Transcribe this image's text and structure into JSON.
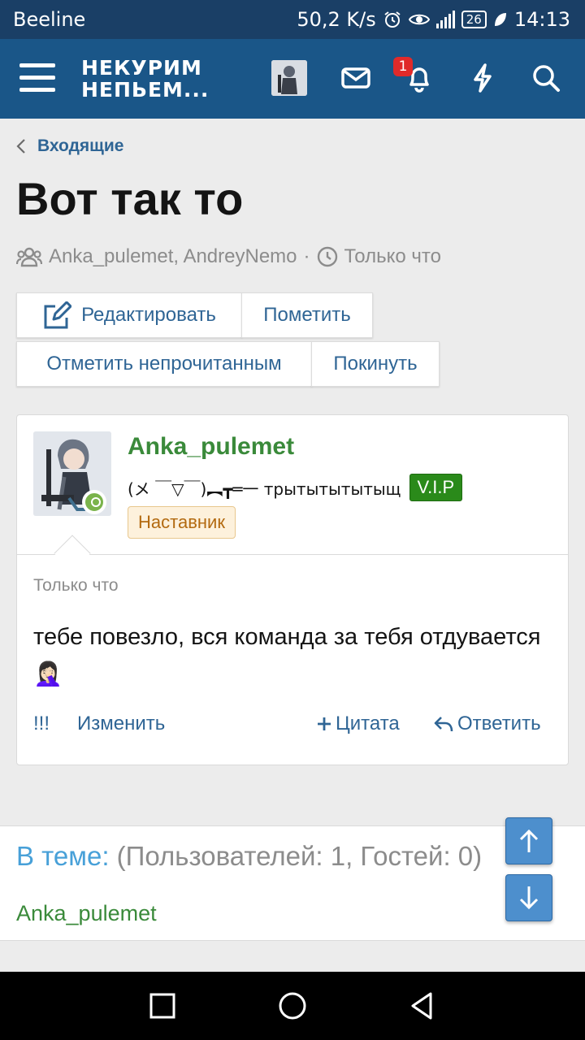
{
  "status_bar": {
    "carrier": "Beeline",
    "speed": "50,2 K/s",
    "battery": "26",
    "time": "14:13"
  },
  "header": {
    "logo_line1": "НЕКУРИМ",
    "logo_line2": "НЕПЬЕМ...",
    "notification_count": "1",
    "icons": [
      "menu-icon",
      "user-avatar",
      "mail-icon",
      "bell-icon",
      "lightning-icon",
      "search-icon"
    ]
  },
  "breadcrumb": {
    "label": "Входящие"
  },
  "conversation": {
    "title": "Вот так то",
    "participants": "Anka_pulemet, AndreyNemo",
    "separator": "·",
    "time": "Только что"
  },
  "actions": {
    "edit": "Редактировать",
    "mark": "Пометить",
    "mark_unread": "Отметить непрочитанным",
    "leave": "Покинуть"
  },
  "message": {
    "username": "Anka_pulemet",
    "user_title": "(メ ￣▽￣)︻┳═一 трытытытытыщ",
    "vip": "V.I.P",
    "role": "Наставник",
    "time": "Только что",
    "body": "тебе повезло, вся команда за тебя отдувается🤦🏻‍♀️",
    "actions": {
      "report": "!!!",
      "edit": "Изменить",
      "quote": "Цитата",
      "reply": "Ответить"
    }
  },
  "online": {
    "label": "В теме:",
    "counts": "(Пользователей: 1, Гостей: 0)",
    "members": [
      "Anka_pulemet"
    ]
  },
  "colors": {
    "header_bg": "#1a5688",
    "status_bg": "#1a3f66",
    "link": "#2f6595",
    "username": "#3a8a3a",
    "vip_bg": "#2a8a1a",
    "online_label": "#47a0d8",
    "badge": "#e02a2a"
  }
}
